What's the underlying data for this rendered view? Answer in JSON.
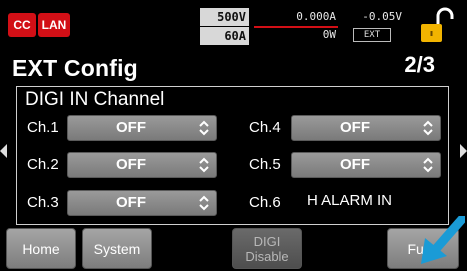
{
  "status": {
    "cc_tag": "CC",
    "lan_tag": "LAN",
    "rated_voltage": "500V",
    "rated_current": "60A",
    "current_readout": "0.000A",
    "power_readout": "0W",
    "voltage_readout": "-0.05V",
    "ext_indicator": "EXT",
    "lock_icon": "padlock-unlocked-icon"
  },
  "header": {
    "title": "EXT Config",
    "page": "2/3"
  },
  "panel": {
    "heading": "DIGI IN Channel",
    "channels": [
      {
        "label": "Ch.1",
        "value": "OFF"
      },
      {
        "label": "Ch.2",
        "value": "OFF"
      },
      {
        "label": "Ch.3",
        "value": "OFF"
      },
      {
        "label": "Ch.4",
        "value": "OFF"
      },
      {
        "label": "Ch.5",
        "value": "OFF"
      },
      {
        "label": "Ch.6",
        "value": "H ALARM IN"
      }
    ]
  },
  "buttons": {
    "home": "Home",
    "system": "System",
    "digi_disable_line1": "DIGI",
    "digi_disable_line2": "Disable",
    "func": "Func"
  },
  "colors": {
    "alert_red": "#d20f16",
    "lock_yellow": "#f2b400",
    "pointer_blue": "#1a9bd6"
  }
}
